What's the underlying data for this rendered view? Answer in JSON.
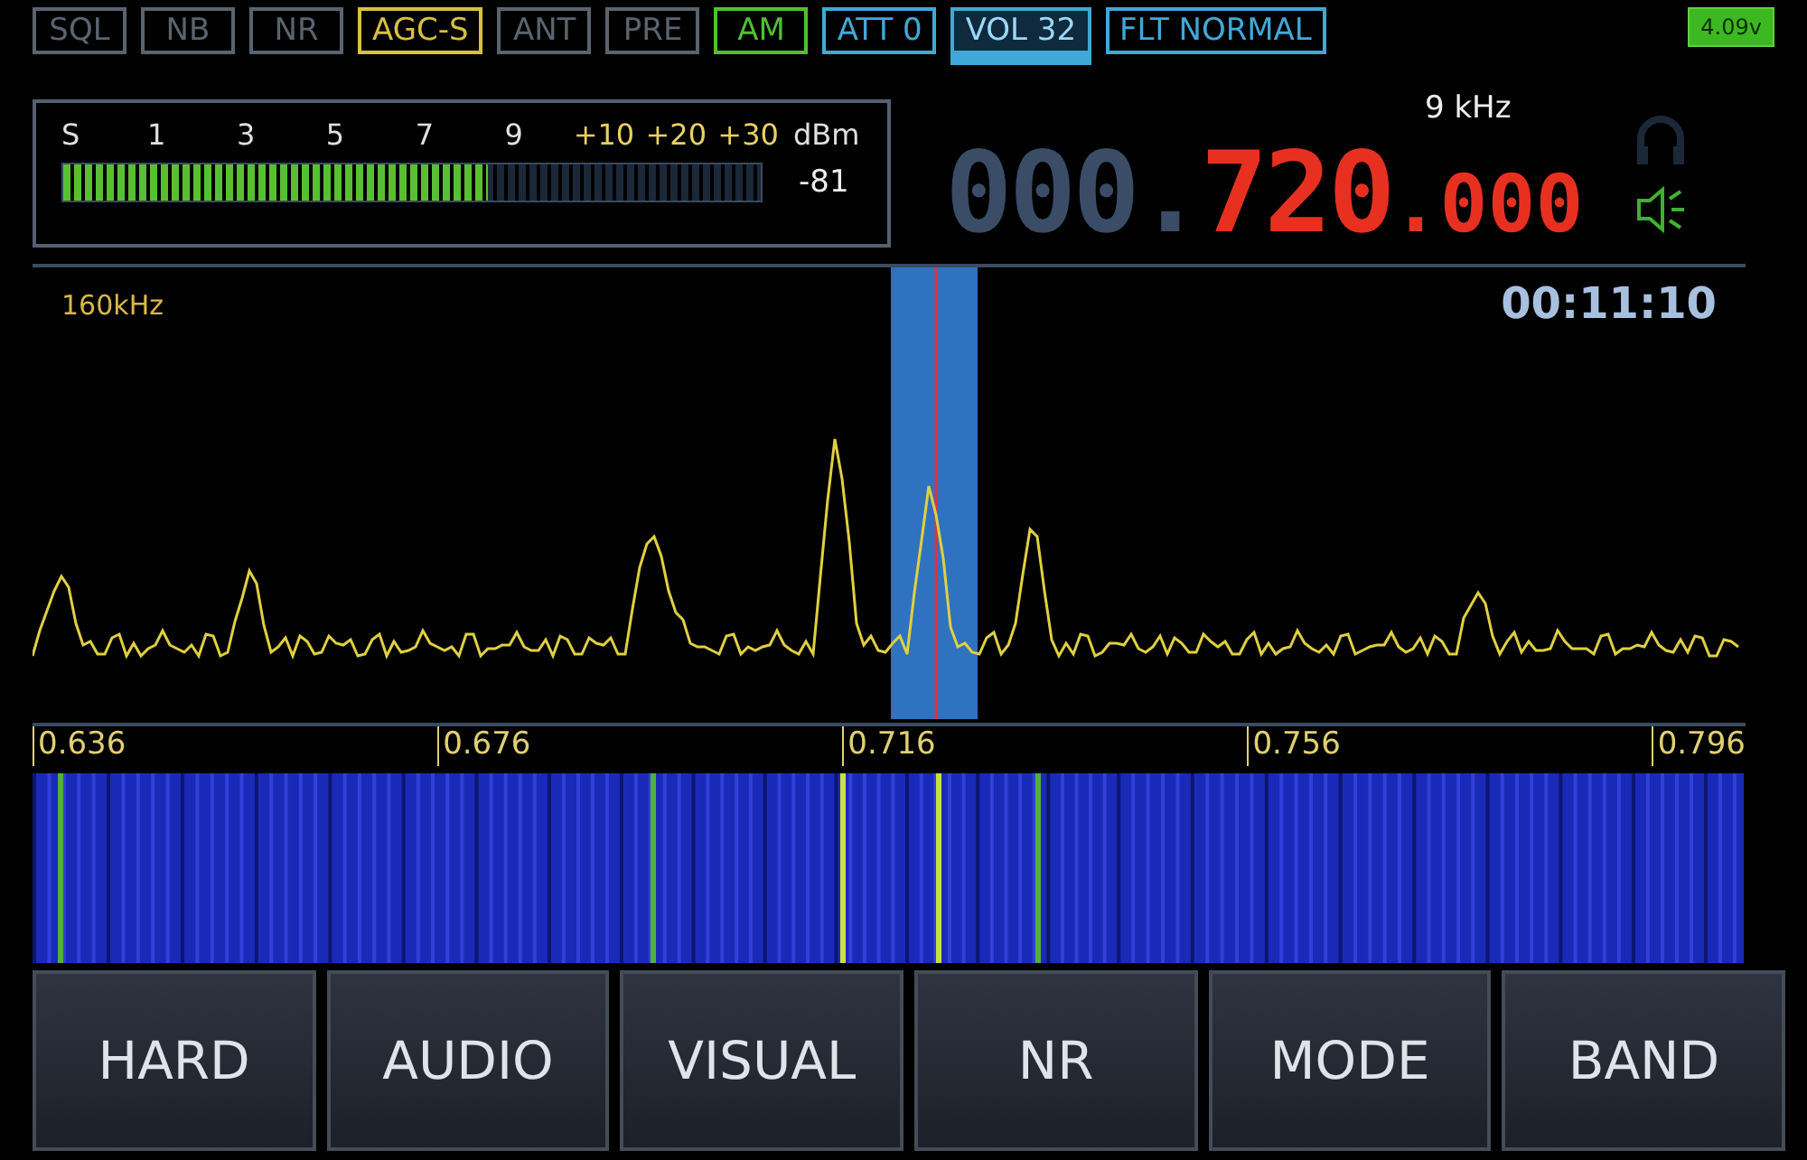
{
  "status_bar": {
    "toggles": [
      {
        "label": "SQL",
        "color": "#5a6470",
        "selected": false
      },
      {
        "label": "NB",
        "color": "#5a6470",
        "selected": false
      },
      {
        "label": "NR",
        "color": "#5a6470",
        "selected": false
      },
      {
        "label": "AGC-S",
        "color": "#d8c040",
        "selected": false
      },
      {
        "label": "ANT",
        "color": "#5a6470",
        "selected": false
      },
      {
        "label": "PRE",
        "color": "#5a6470",
        "selected": false
      },
      {
        "label": "AM",
        "color": "#50c030",
        "selected": false
      },
      {
        "label": "ATT 0",
        "color": "#40a8d8",
        "selected": false
      },
      {
        "label": "VOL 32",
        "color": "#40a8d8",
        "selected": true
      },
      {
        "label": "FLT NORMAL",
        "color": "#40a8d8",
        "selected": false
      }
    ],
    "battery": "4.09v"
  },
  "meter": {
    "scale": [
      "S",
      "1",
      "3",
      "5",
      "7",
      "9",
      "+10",
      "+20",
      "+30"
    ],
    "unit": "dBm",
    "level": 0.61,
    "reading": "-81"
  },
  "frequency": {
    "ghost_digits": "000.",
    "value": "720",
    "decimals": ".000",
    "step": "9 kHz"
  },
  "spectrum": {
    "span": "160kHz",
    "time": "00:11:10",
    "axis": [
      "0.636",
      "0.676",
      "0.716",
      "0.756",
      "0.796"
    ]
  },
  "buttons": [
    "HARD",
    "AUDIO",
    "VISUAL",
    "NR",
    "MODE",
    "BAND"
  ]
}
